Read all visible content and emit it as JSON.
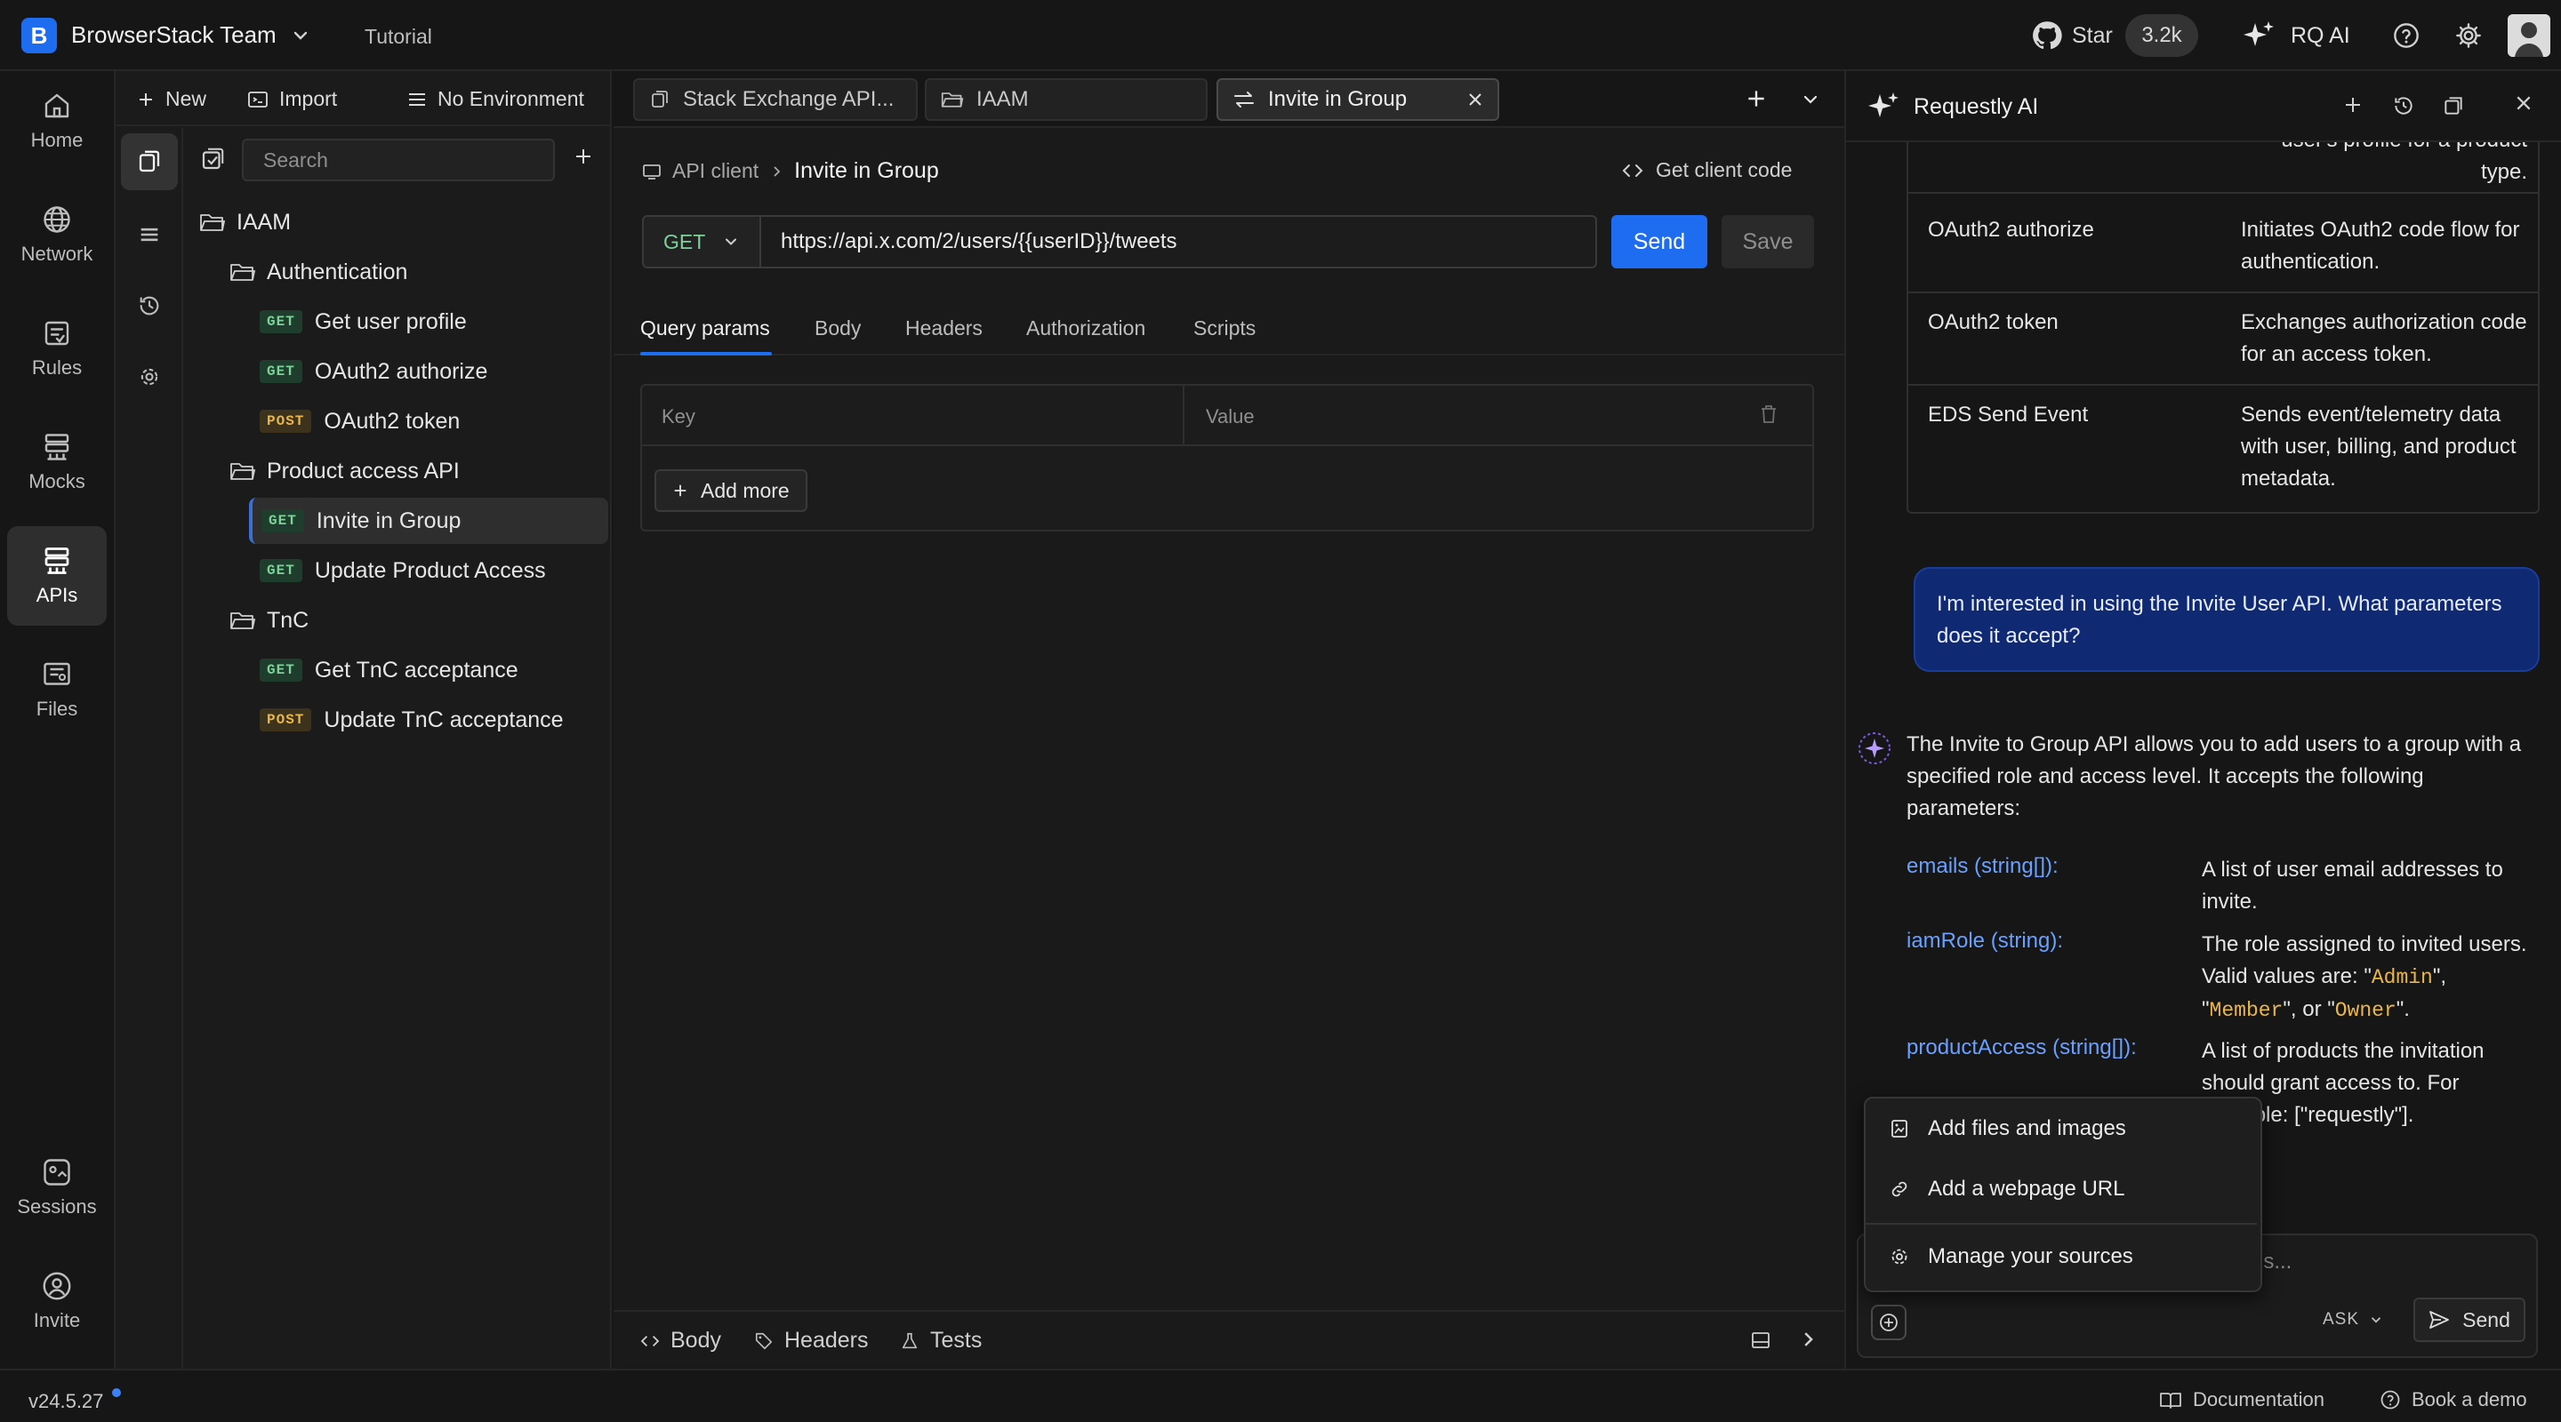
{
  "app": {
    "team_initial": "B",
    "team_name": "BrowserStack Team",
    "tutorial": "Tutorial",
    "star_label": "Star",
    "star_count": "3.2k",
    "rq_ai": "RQ AI",
    "accent_color": "#1e6cf0"
  },
  "nav": {
    "items": [
      {
        "label": "Home",
        "icon": "home-icon"
      },
      {
        "label": "Network",
        "icon": "globe-icon"
      },
      {
        "label": "Rules",
        "icon": "rules-icon"
      },
      {
        "label": "Mocks",
        "icon": "mocks-icon"
      },
      {
        "label": "APIs",
        "icon": "apis-icon"
      },
      {
        "label": "Files",
        "icon": "files-icon"
      },
      {
        "label": "Sessions",
        "icon": "sessions-icon"
      },
      {
        "label": "Invite",
        "icon": "invite-icon"
      }
    ]
  },
  "sidebar": {
    "new_label": "New",
    "import_label": "Import",
    "env_label": "No Environment",
    "search_placeholder": "Search",
    "tree": {
      "root": "IAAM",
      "folders": [
        {
          "name": "Authentication",
          "items": [
            {
              "method": "GET",
              "name": "Get user profile"
            },
            {
              "method": "GET",
              "name": "OAuth2 authorize"
            },
            {
              "method": "POST",
              "name": "OAuth2 token"
            }
          ]
        },
        {
          "name": "Product access API",
          "items": [
            {
              "method": "GET",
              "name": "Invite in Group"
            },
            {
              "method": "GET",
              "name": "Update Product Access"
            }
          ]
        },
        {
          "name": "TnC",
          "items": [
            {
              "method": "GET",
              "name": "Get TnC acceptance"
            },
            {
              "method": "POST",
              "name": "Update TnC acceptance"
            }
          ]
        }
      ]
    }
  },
  "tabs": [
    {
      "label": "Stack Exchange API..."
    },
    {
      "label": "IAAM"
    },
    {
      "label": "Invite in Group"
    }
  ],
  "request": {
    "breadcrumb_root": "API client",
    "breadcrumb_current": "Invite in Group",
    "get_code": "Get client code",
    "method": "GET",
    "url": "https://api.x.com/2/users/{{userID}}/tweets",
    "send": "Send",
    "save": "Save",
    "tabs": [
      "Query params",
      "Body",
      "Headers",
      "Authorization",
      "Scripts"
    ],
    "kv_key": "Key",
    "kv_value": "Value",
    "add_more": "Add more"
  },
  "response_bar": {
    "body": "Body",
    "headers": "Headers",
    "tests": "Tests"
  },
  "ai": {
    "title": "Requestly AI",
    "table_rows": [
      {
        "name": "",
        "desc": "user's profile for a product type."
      },
      {
        "name": "OAuth2 authorize",
        "desc": "Initiates OAuth2 code flow for authentication."
      },
      {
        "name": "OAuth2 token",
        "desc": "Exchanges authorization code for an access token."
      },
      {
        "name": "EDS Send Event",
        "desc": "Sends event/telemetry data with user, billing, and product metadata."
      }
    ],
    "user_message": "I'm interested in using the Invite User API. What parameters does it accept?",
    "answer_intro": "The Invite to Group API allows you to add users to a group with a specified role and access level. It accepts the following parameters:",
    "params": [
      {
        "name": "emails (string[]):",
        "desc": "A list of user email addresses to invite."
      },
      {
        "name": "iamRole (string):",
        "desc_pre": "The role assigned to invited users. Valid values are: \"",
        "v1": "Admin",
        "mid1": "\", \"",
        "v2": "Member",
        "mid2": "\", or \"",
        "v3": "Owner",
        "desc_post": "\"."
      },
      {
        "name": "productAccess (string[]):",
        "desc": "A list of products the invitation should grant access to. For example: [\"requestly\"]."
      }
    ],
    "input_placeholder_tail": "ls...",
    "mode": "ASK",
    "send": "Send",
    "popup": [
      {
        "label": "Add files and images",
        "icon": "image-file-icon"
      },
      {
        "label": "Add a webpage URL",
        "icon": "link-icon"
      },
      {
        "label": "Manage your sources",
        "icon": "gear-icon"
      }
    ]
  },
  "status": {
    "version": "v24.5.27",
    "documentation": "Documentation",
    "book_demo": "Book a demo"
  }
}
